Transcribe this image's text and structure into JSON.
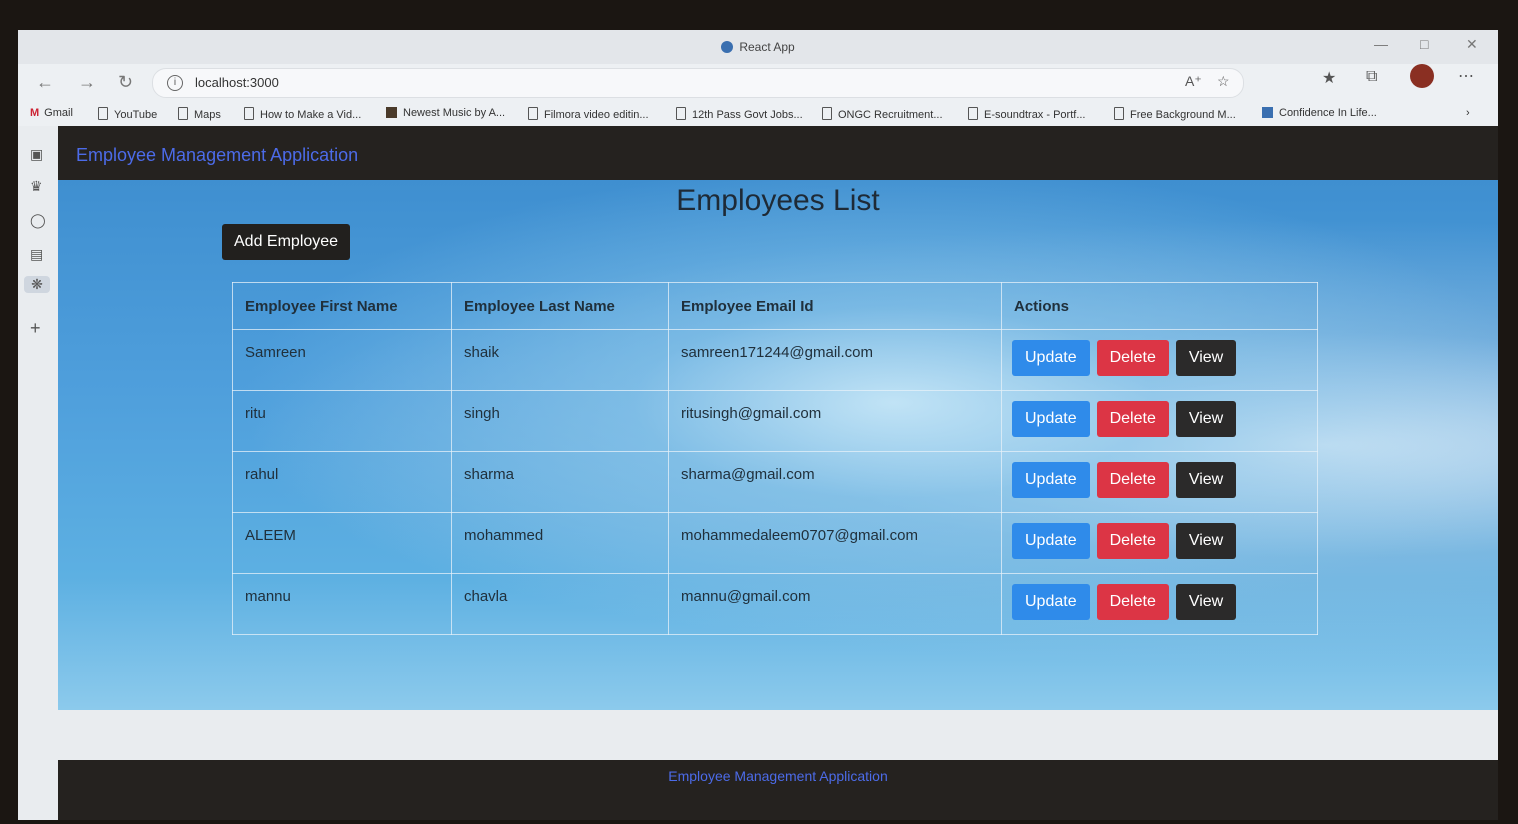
{
  "browser": {
    "window_title": "React App",
    "url": "localhost:3000",
    "bookmarks": [
      "Gmail",
      "YouTube",
      "Maps",
      "How to Make a Vid...",
      "Newest Music by A...",
      "Filmora video editin...",
      "12th Pass Govt Jobs...",
      "ONGC Recruitment...",
      "E-soundtrax - Portf...",
      "Free Background M...",
      "Confidence In Life..."
    ]
  },
  "app": {
    "brand": "Employee Management Application",
    "heading": "Employees List",
    "add_button": "Add Employee",
    "columns": [
      "Employee First Name",
      "Employee Last Name",
      "Employee Email Id",
      "Actions"
    ],
    "employees": [
      {
        "first": "Samreen",
        "last": "shaik",
        "email": "samreen171244@gmail.com"
      },
      {
        "first": "ritu",
        "last": "singh",
        "email": "ritusingh@gmail.com"
      },
      {
        "first": "rahul",
        "last": "sharma",
        "email": "sharma@gmail.com"
      },
      {
        "first": "ALEEM",
        "last": "mohammed",
        "email": "mohammedaleem0707@gmail.com"
      },
      {
        "first": "mannu",
        "last": "chavla",
        "email": "mannu@gmail.com"
      }
    ],
    "actions": {
      "update": "Update",
      "delete": "Delete",
      "view": "View"
    },
    "footer": "Employee Management Application"
  },
  "colors": {
    "nav_bg": "#25221f",
    "brand_text": "#4c6be8",
    "update": "#2f8bea",
    "delete": "#dc3545",
    "view": "#2b2a2a"
  }
}
